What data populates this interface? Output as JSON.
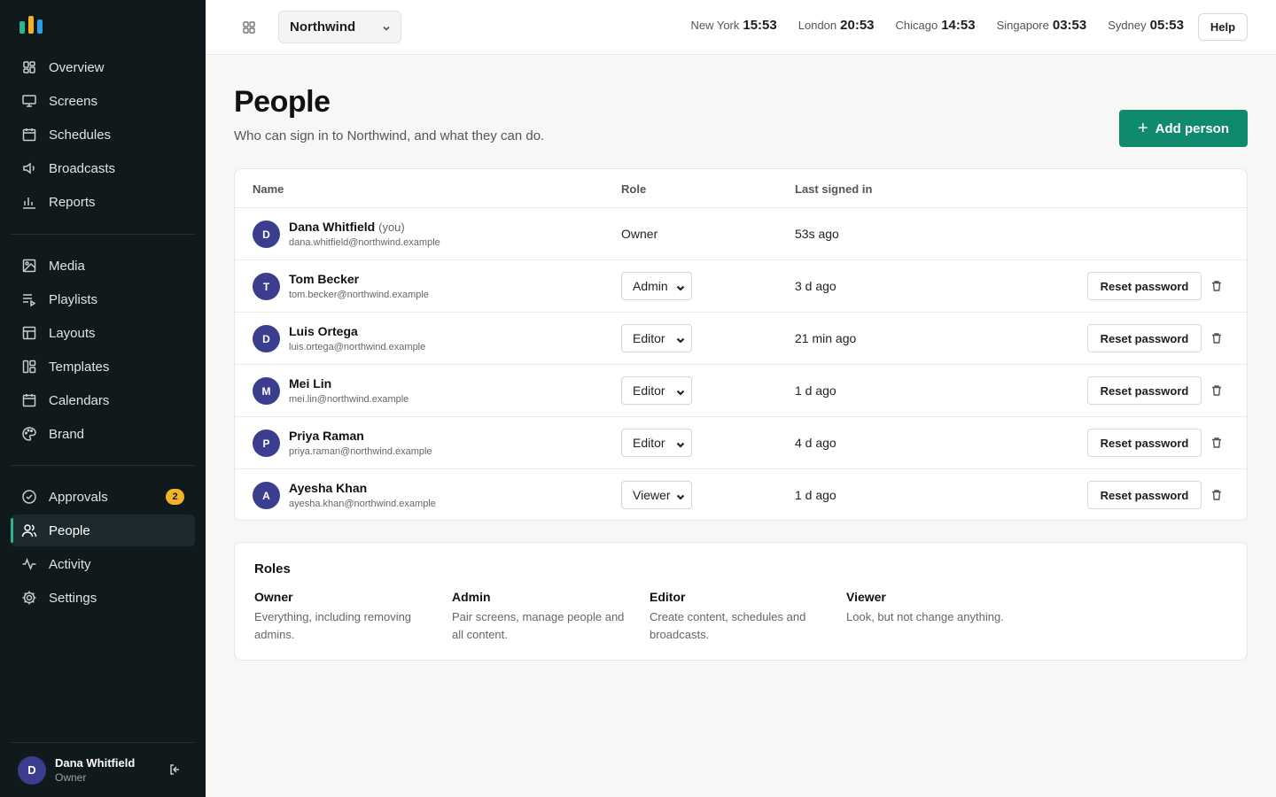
{
  "brand": {
    "accent": "#0f8a6e",
    "logo_colors": [
      "#2fb38f",
      "#f0b429",
      "#2f9de0"
    ]
  },
  "sidebar": {
    "groups": [
      [
        {
          "label": "Overview",
          "icon": "grid-icon"
        },
        {
          "label": "Screens",
          "icon": "monitor-icon"
        },
        {
          "label": "Schedules",
          "icon": "calendar-icon"
        },
        {
          "label": "Broadcasts",
          "icon": "speaker-icon"
        },
        {
          "label": "Reports",
          "icon": "bar-chart-icon"
        }
      ],
      [
        {
          "label": "Media",
          "icon": "image-icon"
        },
        {
          "label": "Playlists",
          "icon": "playlist-icon"
        },
        {
          "label": "Layouts",
          "icon": "layout-icon"
        },
        {
          "label": "Templates",
          "icon": "templates-icon"
        },
        {
          "label": "Calendars",
          "icon": "calendar-icon"
        },
        {
          "label": "Brand",
          "icon": "palette-icon"
        }
      ],
      [
        {
          "label": "Approvals",
          "icon": "check-circle-icon",
          "badge": "2"
        },
        {
          "label": "People",
          "icon": "users-icon",
          "active": true
        },
        {
          "label": "Activity",
          "icon": "activity-icon"
        },
        {
          "label": "Settings",
          "icon": "gear-icon"
        }
      ]
    ],
    "user": {
      "initial": "D",
      "name": "Dana Whitfield",
      "role": "Owner"
    }
  },
  "topbar": {
    "org": "Northwind",
    "clocks": [
      {
        "city": "New York",
        "time": "15:53"
      },
      {
        "city": "London",
        "time": "20:53"
      },
      {
        "city": "Chicago",
        "time": "14:53"
      },
      {
        "city": "Singapore",
        "time": "03:53"
      },
      {
        "city": "Sydney",
        "time": "05:53"
      }
    ],
    "help": "Help"
  },
  "page": {
    "title": "People",
    "subtitle": "Who can sign in to Northwind, and what they can do.",
    "add_button": "Add person"
  },
  "table": {
    "headers": {
      "name": "Name",
      "role": "Role",
      "last": "Last signed in"
    },
    "reset_label": "Reset password",
    "rows": [
      {
        "initial": "D",
        "name": "Dana Whitfield",
        "you": "(you)",
        "email": "dana.whitfield@northwind.example",
        "role": "Owner",
        "editable": false,
        "last": "53s ago"
      },
      {
        "initial": "T",
        "name": "Tom Becker",
        "you": "",
        "email": "tom.becker@northwind.example",
        "role": "Admin",
        "editable": true,
        "last": "3 d ago"
      },
      {
        "initial": "D",
        "name": "Luis Ortega",
        "you": "",
        "email": "luis.ortega@northwind.example",
        "role": "Editor",
        "editable": true,
        "last": "21 min ago"
      },
      {
        "initial": "M",
        "name": "Mei Lin",
        "you": "",
        "email": "mei.lin@northwind.example",
        "role": "Editor",
        "editable": true,
        "last": "1 d ago"
      },
      {
        "initial": "P",
        "name": "Priya Raman",
        "you": "",
        "email": "priya.raman@northwind.example",
        "role": "Editor",
        "editable": true,
        "last": "4 d ago"
      },
      {
        "initial": "A",
        "name": "Ayesha Khan",
        "you": "",
        "email": "ayesha.khan@northwind.example",
        "role": "Viewer",
        "editable": true,
        "last": "1 d ago"
      }
    ]
  },
  "roles": {
    "title": "Roles",
    "items": [
      {
        "name": "Owner",
        "desc": "Everything, including removing admins."
      },
      {
        "name": "Admin",
        "desc": "Pair screens, manage people and all content."
      },
      {
        "name": "Editor",
        "desc": "Create content, schedules and broadcasts."
      },
      {
        "name": "Viewer",
        "desc": "Look, but not change anything."
      }
    ]
  }
}
